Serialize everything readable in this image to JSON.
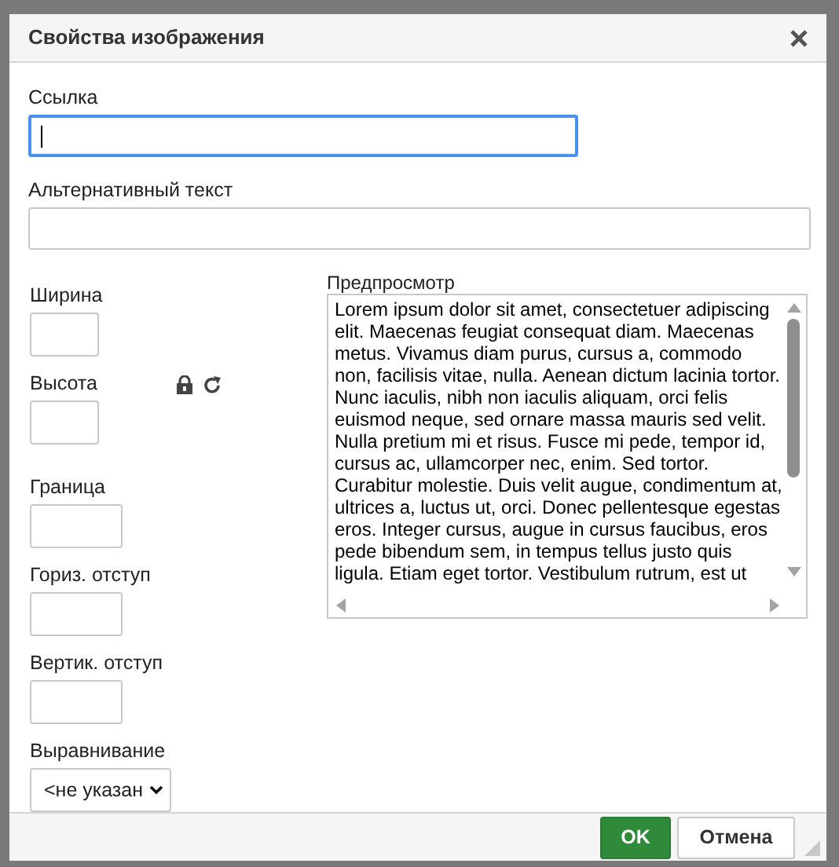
{
  "dialog": {
    "title": "Свойства изображения"
  },
  "fields": [
    {
      "label": "Ссылка",
      "focused": true
    },
    {
      "label": "Альтернативный текст",
      "focused": false
    }
  ],
  "size_fields": [
    {
      "label": "Ширина"
    },
    {
      "label": "Высота"
    },
    {
      "label": "Граница"
    },
    {
      "label": "Гориз. отступ"
    },
    {
      "label": "Вертик. отступ"
    }
  ],
  "align": {
    "label": "Выравнивание",
    "value": "<не указан"
  },
  "preview": {
    "label": "Предпросмотр",
    "lines": [
      "Lorem ipsum dolor sit amet, consectetuer adipiscing",
      "elit. Maecenas feugiat consequat diam. Maecenas",
      "metus. Vivamus diam purus, cursus a, commodo",
      "non, facilisis vitae, nulla. Aenean dictum lacinia tortor.",
      "Nunc iaculis, nibh non iaculis aliquam, orci felis",
      "euismod neque, sed ornare massa mauris sed velit.",
      "Nulla pretium mi et risus. Fusce mi pede, tempor id,",
      "cursus ac, ullamcorper nec, enim. Sed tortor.",
      "Curabitur molestie. Duis velit augue, condimentum at,",
      "ultrices a, luctus ut, orci. Donec pellentesque egestas",
      "eros. Integer cursus, augue in cursus faucibus, eros",
      "pede bibendum sem, in tempus tellus justo quis",
      "ligula. Etiam eget tortor. Vestibulum rutrum, est ut"
    ]
  },
  "buttons": [
    {
      "label": "OK",
      "kind": "primary"
    },
    {
      "label": "Отмена",
      "kind": "secondary"
    }
  ]
}
